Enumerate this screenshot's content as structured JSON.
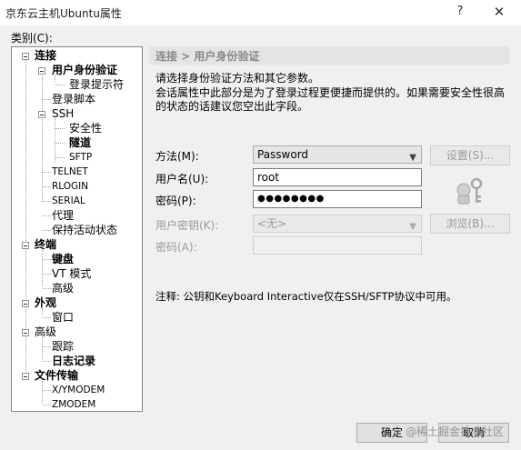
{
  "window": {
    "title": "京东云主机Ubuntu属性",
    "help": "?",
    "close": "✕"
  },
  "category_label": "类别(C):",
  "tree": {
    "connection": "连接",
    "user_auth": "用户身份验证",
    "login_prompt": "登录提示符",
    "login_script": "登录脚本",
    "ssh": "SSH",
    "security": "安全性",
    "tunnel": "隧道",
    "sftp": "SFTP",
    "telnet": "TELNET",
    "rlogin": "RLOGIN",
    "serial": "SERIAL",
    "proxy": "代理",
    "keepalive": "保持活动状态",
    "terminal": "终端",
    "keyboard": "键盘",
    "vt_mode": "VT 模式",
    "advanced": "高级",
    "appearance": "外观",
    "window": "窗口",
    "advanced2": "高级",
    "trace": "跟踪",
    "logging": "日志记录",
    "file_transfer": "文件传输",
    "xymodem": "X/YMODEM",
    "zmodem": "ZMODEM"
  },
  "panel": {
    "section_title": "连接 > 用户身份验证",
    "desc1": "请选择身份验证方法和其它参数。",
    "desc2": "会话属性中此部分是为了登录过程更便捷而提供的。如果需要安全性很高的状态的话建议您空出此字段。",
    "method_label": "方法(M):",
    "method_value": "Password",
    "username_label": "用户名(U):",
    "username_value": "root",
    "password_label": "密码(P):",
    "password_value": "●●●●●●●●",
    "userkey_label": "用户密钥(K):",
    "userkey_value": "<无>",
    "passphrase_label": "密码(A):",
    "setup_button": "设置(S)...",
    "browse_button": "浏览(B)...",
    "note": "注释: 公钥和Keyboard Interactive仅在SSH/SFTP协议中可用。"
  },
  "footer": {
    "ok": "确定",
    "cancel": "取消",
    "watermark": "@稀土掘金技术社区"
  }
}
